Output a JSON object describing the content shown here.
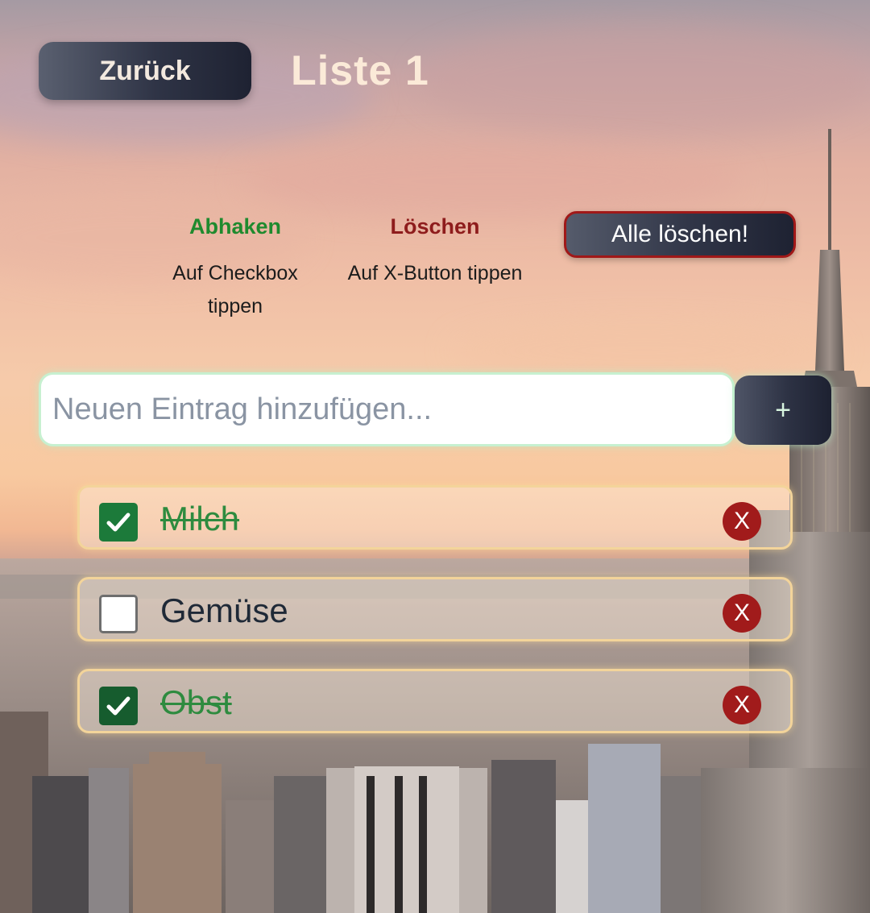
{
  "header": {
    "back_label": "Zurück",
    "title": "Liste 1"
  },
  "instructions": {
    "check_title": "Abhaken",
    "check_text": "Auf Checkbox tippen",
    "delete_title": "Löschen",
    "delete_text": "Auf X-Button tippen"
  },
  "delete_all_label": "Alle löschen!",
  "entry": {
    "placeholder": "Neuen Eintrag hinzufügen...",
    "value": "",
    "add_label": "+"
  },
  "items": [
    {
      "label": "Milch",
      "checked": true,
      "delete_label": "X"
    },
    {
      "label": "Gemüse",
      "checked": false,
      "delete_label": "X"
    },
    {
      "label": "Obst",
      "checked": true,
      "delete_label": "X"
    }
  ],
  "colors": {
    "check_green": "#1f8a2e",
    "delete_red": "#8e1c1c",
    "button_dark": "#2f3446",
    "done_text": "#2e8b3f",
    "x_button": "#a11b1b"
  },
  "icons": {
    "checkmark": "check-icon",
    "delete": "close-x-icon",
    "add": "plus-icon"
  }
}
